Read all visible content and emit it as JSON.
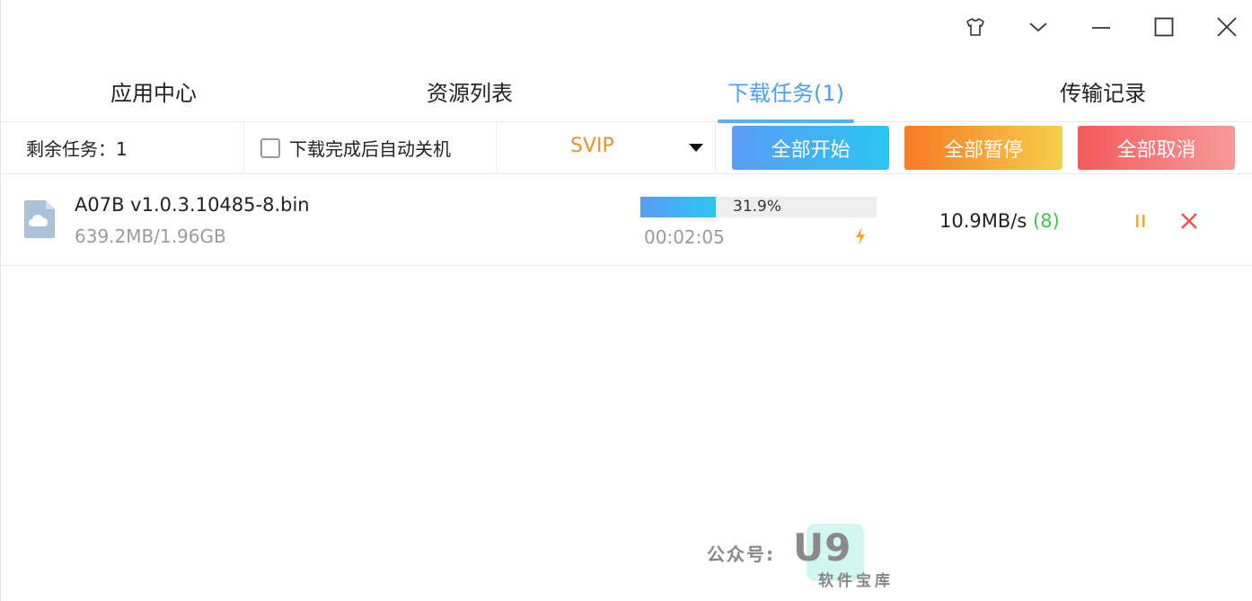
{
  "tabs": [
    {
      "label": "应用中心",
      "active": false
    },
    {
      "label": "资源列表",
      "active": false
    },
    {
      "label": "下载任务(1)",
      "active": true
    },
    {
      "label": "传输记录",
      "active": false
    }
  ],
  "toolbar": {
    "remaining_text": "剩余任务：1",
    "auto_shutdown_label": "下载完成后自动关机",
    "auto_shutdown_checked": false,
    "svip_label": "SVIP",
    "start_all_label": "全部开始",
    "pause_all_label": "全部暂停",
    "cancel_all_label": "全部取消"
  },
  "task": {
    "file_name": "A07B v1.0.3.10485-8.bin",
    "size_progress": "639.2MB/1.96GB",
    "progress_percent": 31.9,
    "progress_text": "31.9%",
    "elapsed": "00:02:05",
    "speed": "10.9MB/s",
    "connections": "(8)"
  },
  "watermark": {
    "label": "公众号:",
    "logo": "U9",
    "sub": "软件宝库"
  },
  "colors": {
    "accent": "#4a9ff5",
    "svip": "#e8912a",
    "pause_icon": "#f5a623",
    "cancel_icon": "#f0545a",
    "connections": "#3cc44c"
  },
  "icons": {
    "skin": "tshirt-icon",
    "menu": "chevron-down-icon",
    "minimize": "minimize-icon",
    "maximize": "maximize-icon",
    "close": "close-icon",
    "file": "cloud-file-icon",
    "boost": "lightning-icon",
    "pause": "pause-icon",
    "cancel": "cancel-icon"
  }
}
